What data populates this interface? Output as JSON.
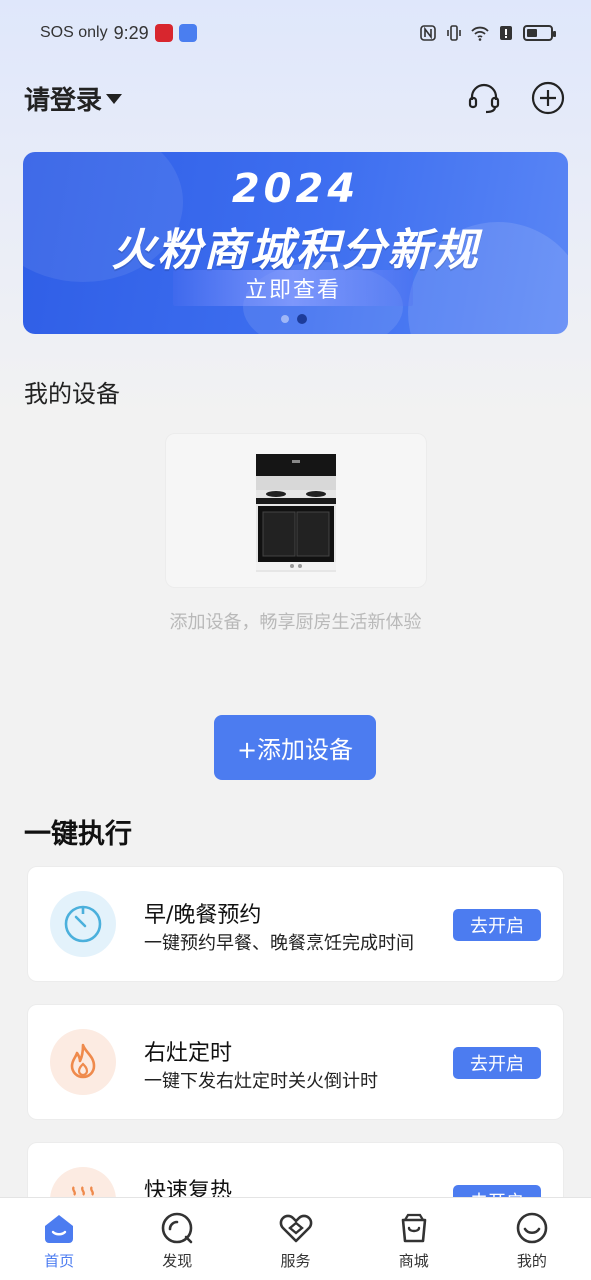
{
  "status_bar": {
    "carrier": "SOS only",
    "time": "9:29"
  },
  "header": {
    "login_label": "请登录",
    "icons": [
      "headset-icon",
      "plus-circle-icon"
    ]
  },
  "banner": {
    "year": "2024",
    "title": "火粉商城积分新规",
    "cta": "立即查看",
    "slide_count": 2,
    "active_slide": 2
  },
  "devices": {
    "section_title": "我的设备",
    "hint": "添加设备，畅享厨房生活新体验",
    "add_button": "+添加设备"
  },
  "onekey": {
    "title": "一键执行",
    "tasks": [
      {
        "title": "早/晚餐预约",
        "desc": "一键预约早餐、晚餐烹饪完成时间",
        "button": "去开启",
        "icon": "timer-icon"
      },
      {
        "title": "右灶定时",
        "desc": "一键下发右灶定时关火倒计时",
        "button": "去开启",
        "icon": "flame-icon"
      },
      {
        "title": "快速复热",
        "desc": "",
        "button": "去开启",
        "icon": "steam-icon"
      }
    ]
  },
  "nav": {
    "items": [
      {
        "label": "首页",
        "icon": "home-icon"
      },
      {
        "label": "发现",
        "icon": "discover-icon"
      },
      {
        "label": "服务",
        "icon": "service-icon"
      },
      {
        "label": "商城",
        "icon": "bag-icon"
      },
      {
        "label": "我的",
        "icon": "smile-icon"
      }
    ],
    "active": "首页"
  },
  "colors": {
    "accent": "#4c7cf0",
    "banner": "#3e6ff0",
    "timer_bg": "#e3f2fb",
    "timer_fg": "#4bb0dc",
    "flame_bg": "#fcebe2",
    "flame_fg": "#ef8a4c"
  }
}
